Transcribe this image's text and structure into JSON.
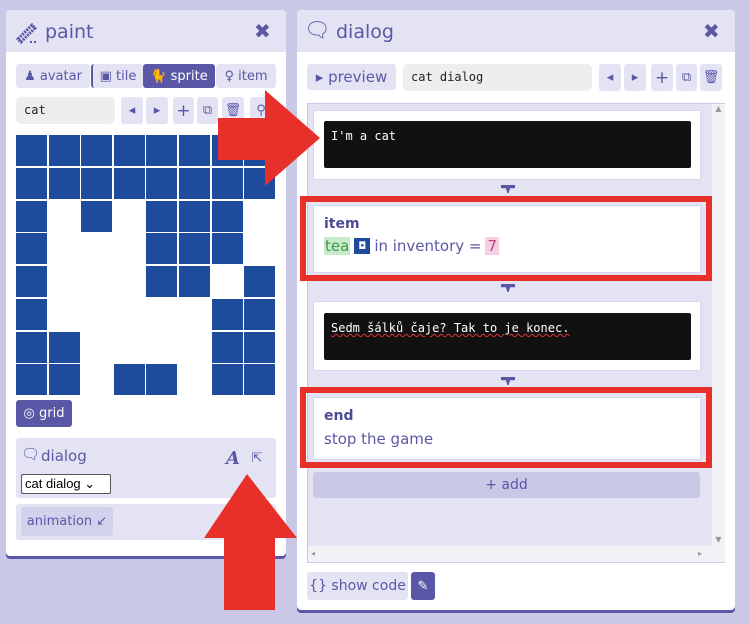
{
  "paint": {
    "title": "paint",
    "tabs": [
      {
        "label": "avatar",
        "icon": "avatar-icon"
      },
      {
        "label": "tile",
        "icon": "tile-icon"
      },
      {
        "label": "sprite",
        "icon": "sprite-icon",
        "selected": true
      },
      {
        "label": "item",
        "icon": "item-icon"
      }
    ],
    "name_value": "cat",
    "grid_label": "grid",
    "sprite_pixels": [
      "11111111",
      "11111111",
      "10101110",
      "10001110",
      "10001101",
      "10000011",
      "11000011",
      "11011011"
    ],
    "sprite_color": "#1e4b9c",
    "dialog_label": "dialog",
    "dialog_select": "cat dialog",
    "animation_label": "animation"
  },
  "dialog": {
    "title": "dialog",
    "preview_label": "preview",
    "name_value": "cat dialog",
    "blocks": {
      "text1": "I'm a cat",
      "item_title": "item",
      "item_name": "tea",
      "item_text": "in inventory =",
      "item_value": "7",
      "text2": "Sedm šálků čaje? Tak to je konec.",
      "end_title": "end",
      "end_text": "stop the game"
    },
    "add_label": "+ add",
    "show_code_label": "show code"
  },
  "colors": {
    "accent": "#5a58a6",
    "annotation": "#e8302a",
    "background": "#c9c8e6"
  }
}
